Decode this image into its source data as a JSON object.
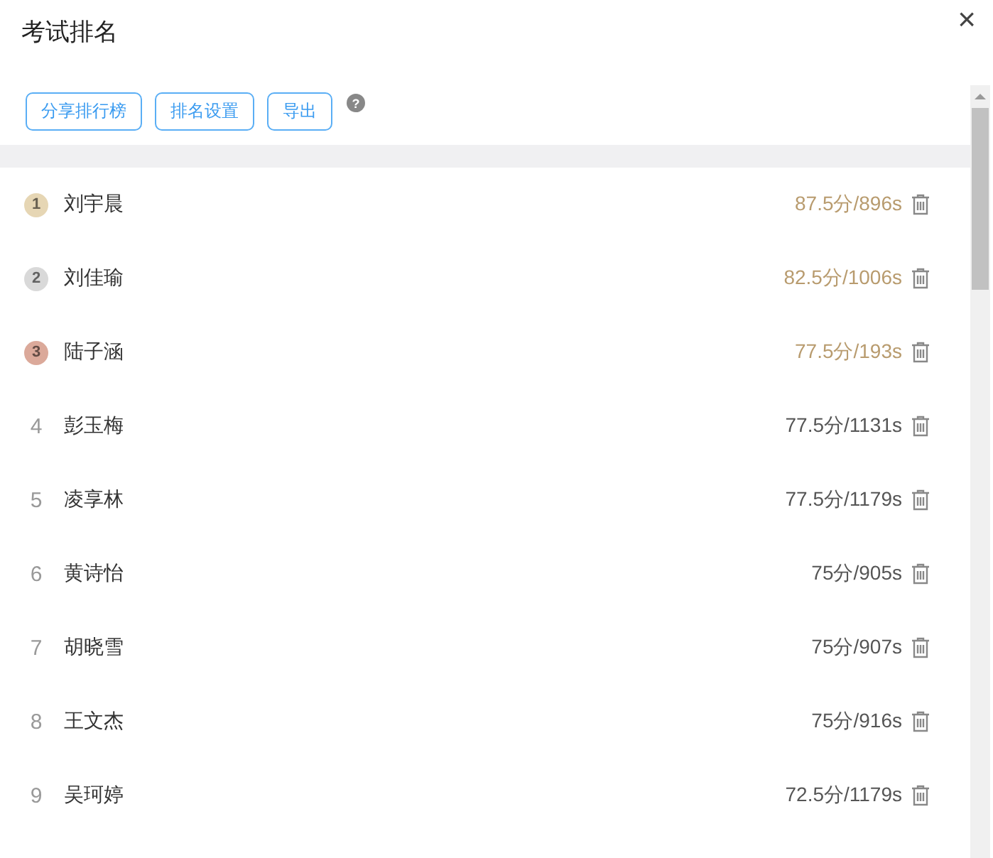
{
  "title": "考试排名",
  "close": "×",
  "toolbar": {
    "buttons": [
      "分享排行榜",
      "排名设置",
      "导出"
    ],
    "help": "?"
  },
  "rows": [
    {
      "kind": "medal",
      "rank": "1",
      "color": "#e6d6b4",
      "name": "刘宇晨",
      "score": "87.5分/896s"
    },
    {
      "kind": "medal",
      "rank": "2",
      "color": "#d9d9d9",
      "name": "刘佳瑜",
      "score": "82.5分/1006s"
    },
    {
      "kind": "medal",
      "rank": "3",
      "color": "#dba99a",
      "name": "陆子涵",
      "score": "77.5分/193s"
    },
    {
      "kind": "plain",
      "rank": "4",
      "name": "彭玉梅",
      "score": "77.5分/1131s"
    },
    {
      "kind": "plain",
      "rank": "5",
      "name": "凌享林",
      "score": "77.5分/1179s"
    },
    {
      "kind": "plain",
      "rank": "6",
      "name": "黄诗怡",
      "score": "75分/905s"
    },
    {
      "kind": "plain",
      "rank": "7",
      "name": "胡晓雪",
      "score": "75分/907s"
    },
    {
      "kind": "plain",
      "rank": "8",
      "name": "王文杰",
      "score": "75分/916s"
    },
    {
      "kind": "plain",
      "rank": "9",
      "name": "吴珂婷",
      "score": "72.5分/1179s"
    }
  ]
}
